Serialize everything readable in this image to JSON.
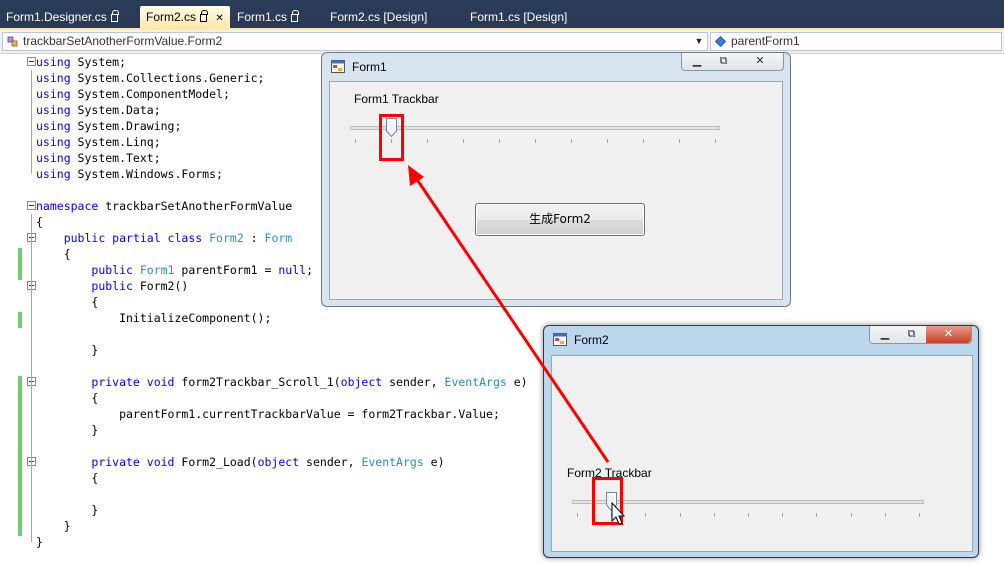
{
  "ide": {
    "tabs": [
      {
        "label": "Form1.Designer.cs",
        "locked": true
      },
      {
        "label": "Form2.cs",
        "locked": true,
        "active": true
      },
      {
        "label": "Form1.cs",
        "locked": true
      },
      {
        "label": "Form2.cs [Design]",
        "locked": false
      },
      {
        "label": "Form1.cs [Design]",
        "locked": false
      }
    ],
    "nav": {
      "type_combo": "trackbarSetAnotherFormValue.Form2",
      "member_combo": "parentForm1"
    },
    "accent_color": "#ffe8a6",
    "tabbar_color": "#293955"
  },
  "code": {
    "lines": [
      [
        [
          "kw",
          "using"
        ],
        [
          "t",
          " System;"
        ]
      ],
      [
        [
          "kw",
          "using"
        ],
        [
          "t",
          " System.Collections.Generic;"
        ]
      ],
      [
        [
          "kw",
          "using"
        ],
        [
          "t",
          " System.ComponentModel;"
        ]
      ],
      [
        [
          "kw",
          "using"
        ],
        [
          "t",
          " System.Data;"
        ]
      ],
      [
        [
          "kw",
          "using"
        ],
        [
          "t",
          " System.Drawing;"
        ]
      ],
      [
        [
          "kw",
          "using"
        ],
        [
          "t",
          " System.Linq;"
        ]
      ],
      [
        [
          "kw",
          "using"
        ],
        [
          "t",
          " System.Text;"
        ]
      ],
      [
        [
          "kw",
          "using"
        ],
        [
          "t",
          " System.Windows.Forms;"
        ]
      ],
      [],
      [
        [
          "kw",
          "namespace"
        ],
        [
          "t",
          " trackbarSetAnotherFormValue"
        ]
      ],
      [
        [
          "t",
          "{"
        ]
      ],
      [
        [
          "t",
          "    "
        ],
        [
          "kw",
          "public partial class"
        ],
        [
          "t",
          " "
        ],
        [
          "ty",
          "Form2"
        ],
        [
          "t",
          " : "
        ],
        [
          "ty",
          "Form"
        ]
      ],
      [
        [
          "t",
          "    {"
        ]
      ],
      [
        [
          "t",
          "        "
        ],
        [
          "kw",
          "public"
        ],
        [
          "t",
          " "
        ],
        [
          "ty",
          "Form1"
        ],
        [
          "t",
          " parentForm1 = "
        ],
        [
          "kw",
          "null"
        ],
        [
          "t",
          ";"
        ]
      ],
      [
        [
          "t",
          "        "
        ],
        [
          "kw",
          "public"
        ],
        [
          "t",
          " Form2()"
        ]
      ],
      [
        [
          "t",
          "        {"
        ]
      ],
      [
        [
          "t",
          "            InitializeComponent();"
        ]
      ],
      [],
      [
        [
          "t",
          "        }"
        ]
      ],
      [],
      [
        [
          "t",
          "        "
        ],
        [
          "kw",
          "private void"
        ],
        [
          "t",
          " form2Trackbar_Scroll_1("
        ],
        [
          "kw",
          "object"
        ],
        [
          "t",
          " sender, "
        ],
        [
          "ty",
          "EventArgs"
        ],
        [
          "t",
          " e)"
        ]
      ],
      [
        [
          "t",
          "        {"
        ]
      ],
      [
        [
          "t",
          "            parentForm1.currentTrackbarValue = form2Trackbar.Value;"
        ]
      ],
      [
        [
          "t",
          "        }"
        ]
      ],
      [],
      [
        [
          "t",
          "        "
        ],
        [
          "kw",
          "private void"
        ],
        [
          "t",
          " Form2_Load("
        ],
        [
          "kw",
          "object"
        ],
        [
          "t",
          " sender, "
        ],
        [
          "ty",
          "EventArgs"
        ],
        [
          "t",
          " e)"
        ]
      ],
      [
        [
          "t",
          "        {"
        ]
      ],
      [],
      [
        [
          "t",
          "        }"
        ]
      ],
      [
        [
          "t",
          "    }"
        ]
      ],
      [
        [
          "t",
          "}"
        ]
      ]
    ],
    "keyword_color": "#0000ff",
    "type_color": "#2b91af"
  },
  "form1": {
    "title": "Form1",
    "trackbar_label": "Form1 Trackbar",
    "trackbar_value_fraction": 0.1,
    "button_label": "生成Form2"
  },
  "form2": {
    "title": "Form2",
    "trackbar_label": "Form2 Trackbar",
    "trackbar_value_fraction": 0.1
  },
  "annotation_color": "#ff0000"
}
